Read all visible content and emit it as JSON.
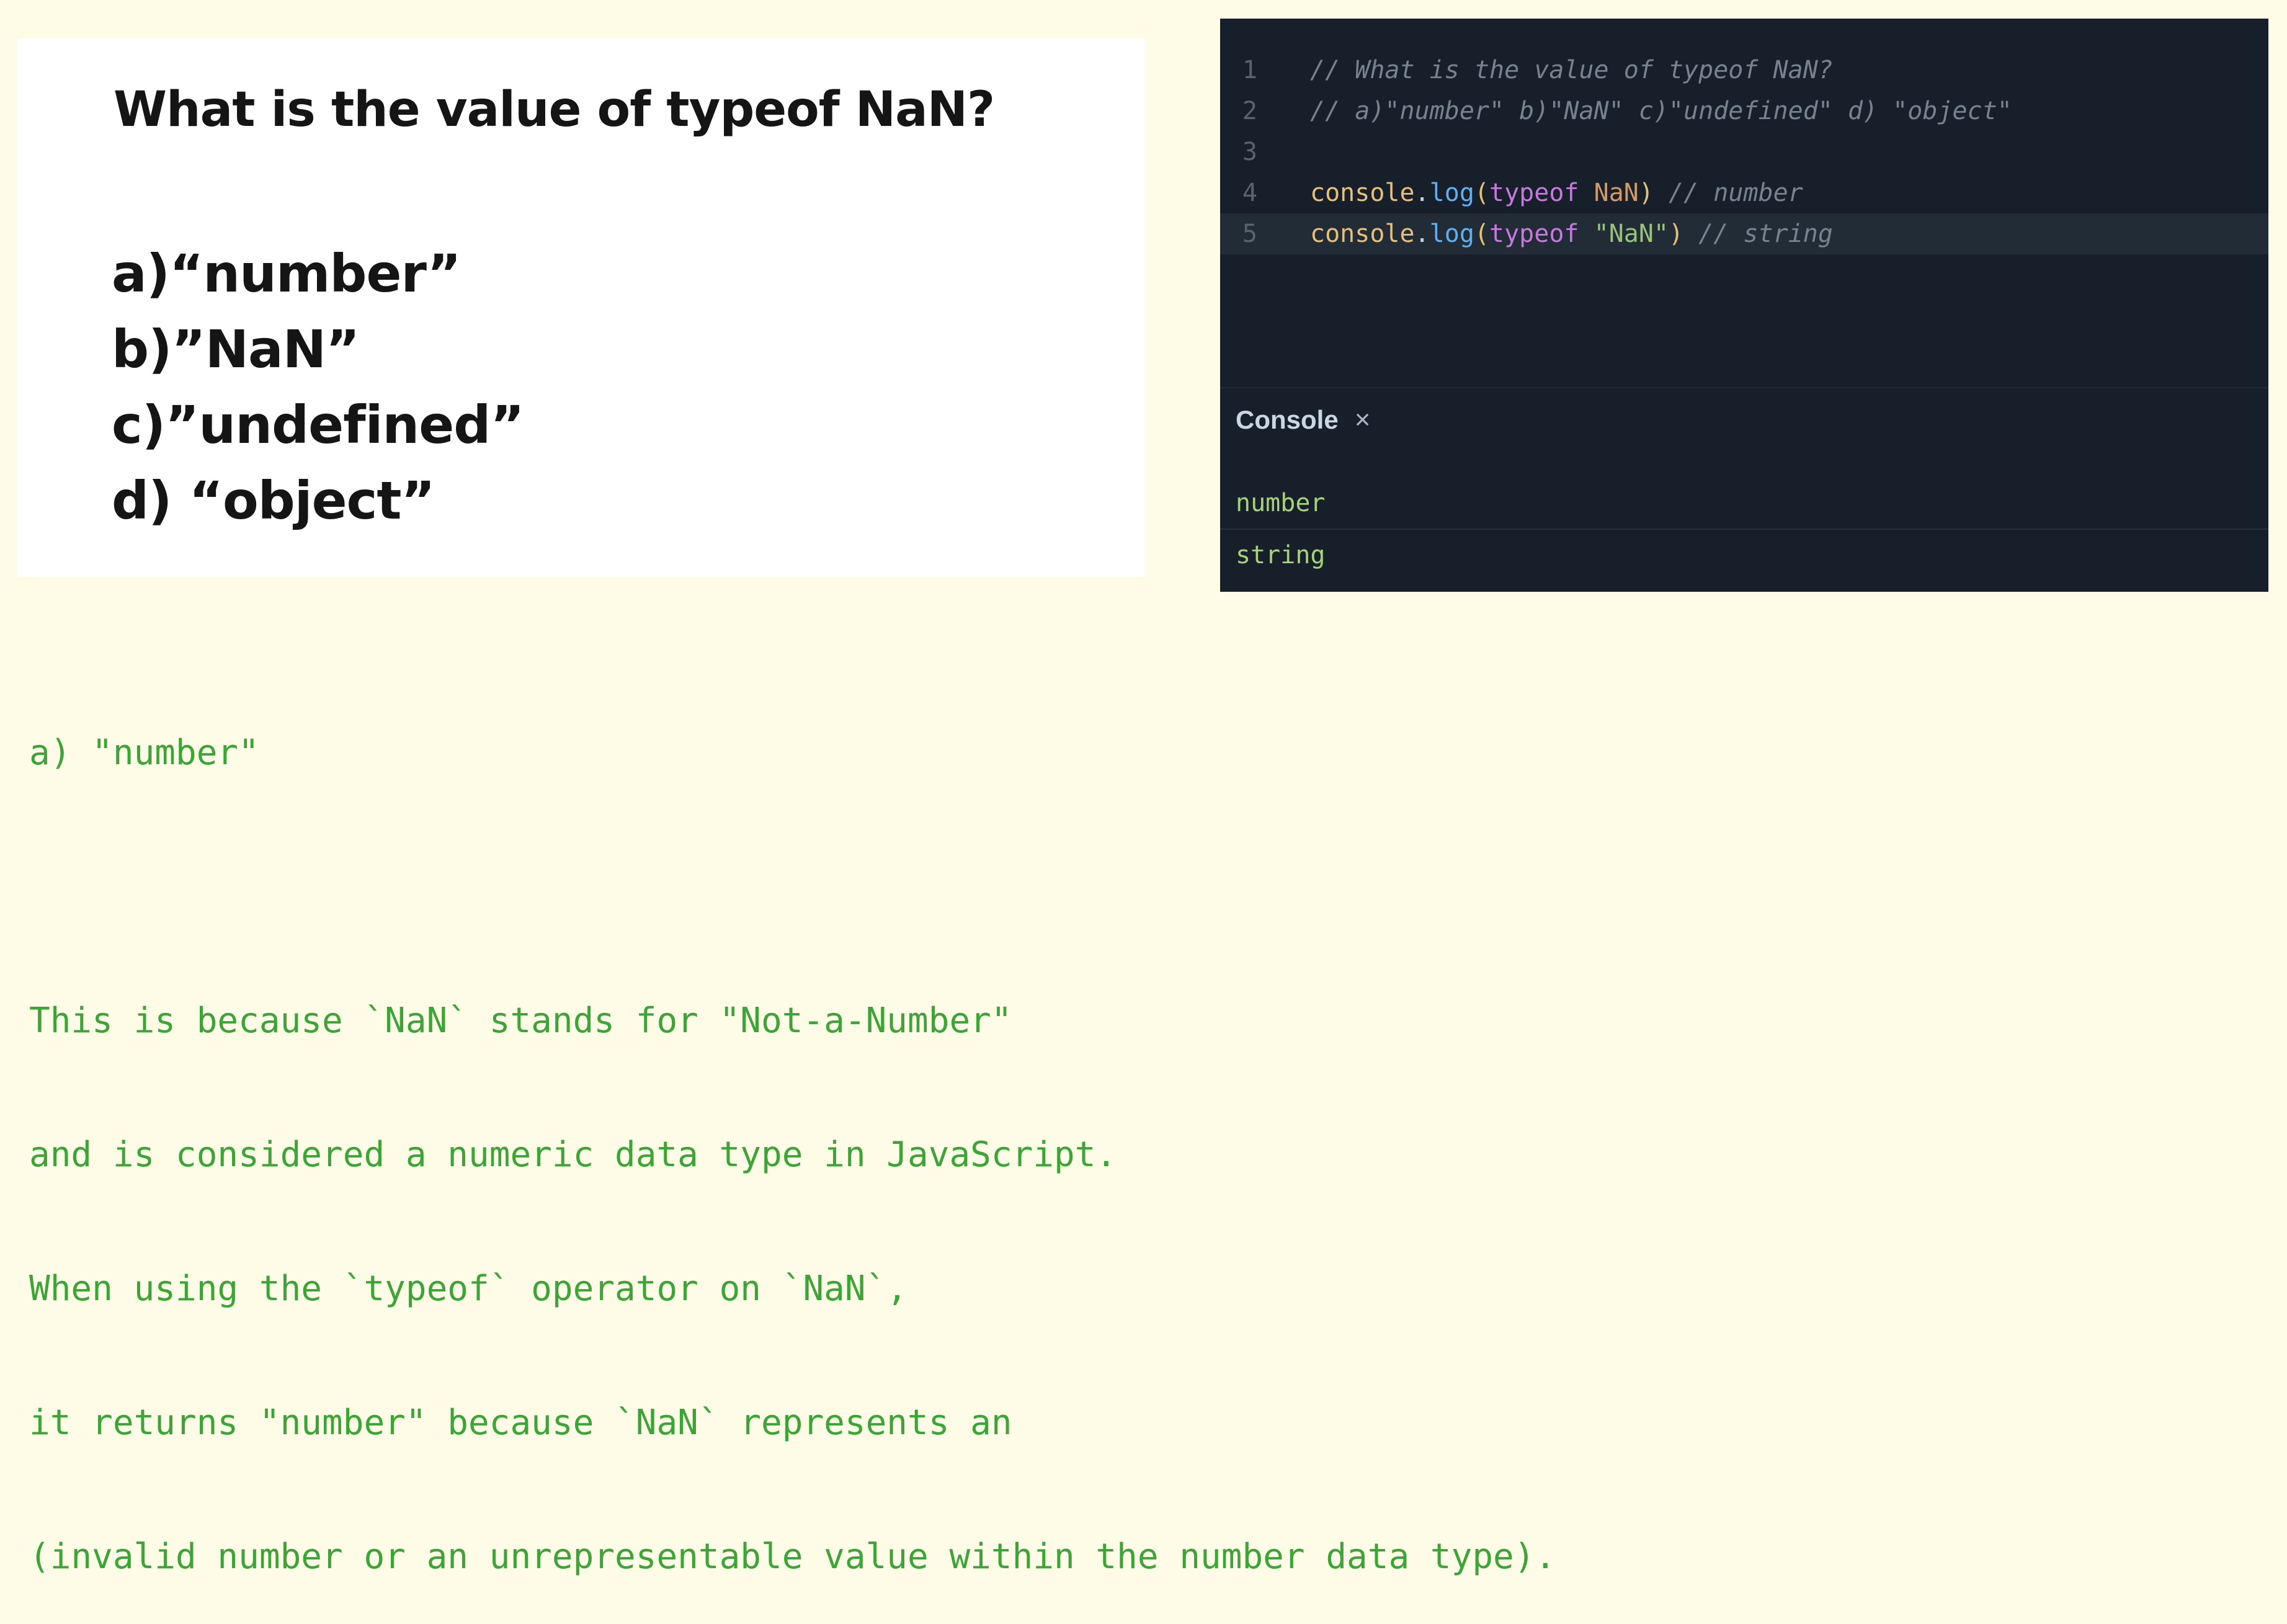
{
  "question": {
    "title": "What is the value of typeof NaN?",
    "options": [
      "a)“number”",
      "b)”NaN”",
      "c)”undefined”",
      "d) “object”"
    ]
  },
  "editor": {
    "lines": [
      {
        "number": "1",
        "tokens": [
          {
            "type": "comment",
            "text": "// What is the value of typeof NaN?"
          }
        ]
      },
      {
        "number": "2",
        "tokens": [
          {
            "type": "comment",
            "text": "// a)\"number\" b)\"NaN\" c)\"undefined\" d) \"object\""
          }
        ]
      },
      {
        "number": "3",
        "tokens": []
      },
      {
        "number": "4",
        "tokens": [
          {
            "type": "obj",
            "text": "console"
          },
          {
            "type": "dot",
            "text": "."
          },
          {
            "type": "fn",
            "text": "log"
          },
          {
            "type": "paren",
            "text": "("
          },
          {
            "type": "kw",
            "text": "typeof"
          },
          {
            "type": "dot",
            "text": " "
          },
          {
            "type": "nan",
            "text": "NaN"
          },
          {
            "type": "paren",
            "text": ")"
          },
          {
            "type": "comment",
            "text": " // number"
          }
        ]
      },
      {
        "number": "5",
        "active": true,
        "tokens": [
          {
            "type": "obj",
            "text": "console"
          },
          {
            "type": "dot",
            "text": "."
          },
          {
            "type": "fn",
            "text": "log"
          },
          {
            "type": "paren",
            "text": "("
          },
          {
            "type": "kw",
            "text": "typeof"
          },
          {
            "type": "dot",
            "text": " "
          },
          {
            "type": "str",
            "text": "\"NaN\""
          },
          {
            "type": "paren",
            "text": ")"
          },
          {
            "type": "comment",
            "text": " // string"
          }
        ]
      }
    ]
  },
  "console": {
    "title": "Console",
    "close_symbol": "×",
    "outputs": [
      "number",
      "string"
    ]
  },
  "answer": {
    "choice": "a) \"number\"",
    "explanation": [
      "This is because `NaN` stands for \"Not-a-Number\"",
      "and is considered a numeric data type in JavaScript.",
      "When using the `typeof` operator on `NaN`,",
      "it returns \"number\" because `NaN` represents an",
      "(invalid number or an unrepresentable value within the number data type)."
    ]
  },
  "colors": {
    "page_background": "#fefbe6",
    "editor_background": "#17202a",
    "answer_text": "#3da538",
    "console_output": "#a7d27a"
  }
}
